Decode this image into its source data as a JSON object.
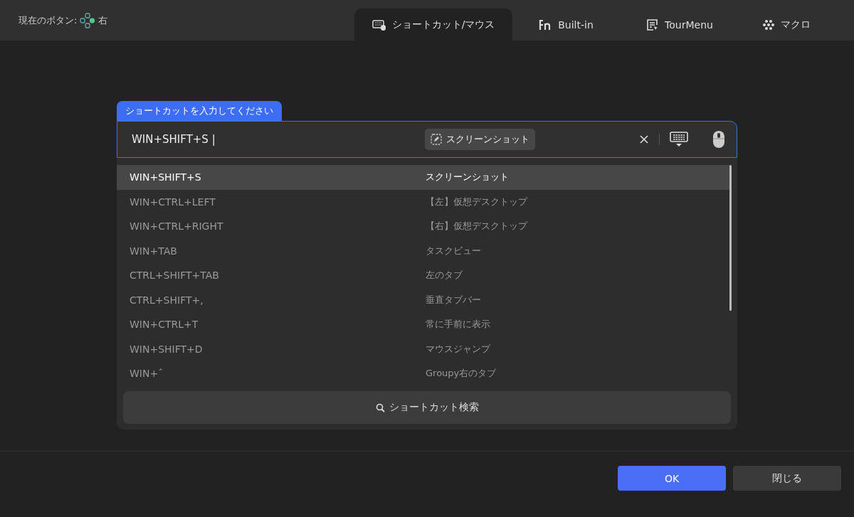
{
  "header": {
    "current_button_label": "現在のボタン:",
    "current_button_value": "右"
  },
  "tabs": [
    {
      "label": "ショートカット/マウス",
      "kind": "keyboard-mouse",
      "selected": true
    },
    {
      "label": "Built-in",
      "kind": "fn",
      "selected": false
    },
    {
      "label": "TourMenu",
      "kind": "menu",
      "selected": false
    },
    {
      "label": "マクロ",
      "kind": "dots",
      "selected": false
    }
  ],
  "input": {
    "label": "ショートカットを入力してください",
    "value": "WIN+SHIFT+S |",
    "chip": "スクリーンショット"
  },
  "shortcuts": [
    {
      "keys": "WIN+SHIFT+S",
      "action": "スクリーンショット",
      "selected": true
    },
    {
      "keys": "WIN+CTRL+LEFT",
      "action": "【左】仮想デスクトップ",
      "selected": false
    },
    {
      "keys": "WIN+CTRL+RIGHT",
      "action": "【右】仮想デスクトップ",
      "selected": false
    },
    {
      "keys": "WIN+TAB",
      "action": "タスクビュー",
      "selected": false
    },
    {
      "keys": "CTRL+SHIFT+TAB",
      "action": "左のタブ",
      "selected": false
    },
    {
      "keys": "CTRL+SHIFT+,",
      "action": "垂直タブバー",
      "selected": false
    },
    {
      "keys": "WIN+CTRL+T",
      "action": "常に手前に表示",
      "selected": false
    },
    {
      "keys": "WIN+SHIFT+D",
      "action": "マウスジャンプ",
      "selected": false
    },
    {
      "keys": "WIN+ˆ",
      "action": "Groupy右のタブ",
      "selected": false
    }
  ],
  "search_button": "ショートカット検索",
  "buttons": [
    {
      "label": "OK",
      "kind": "primary"
    },
    {
      "label": "閉じる",
      "kind": "secondary"
    }
  ]
}
